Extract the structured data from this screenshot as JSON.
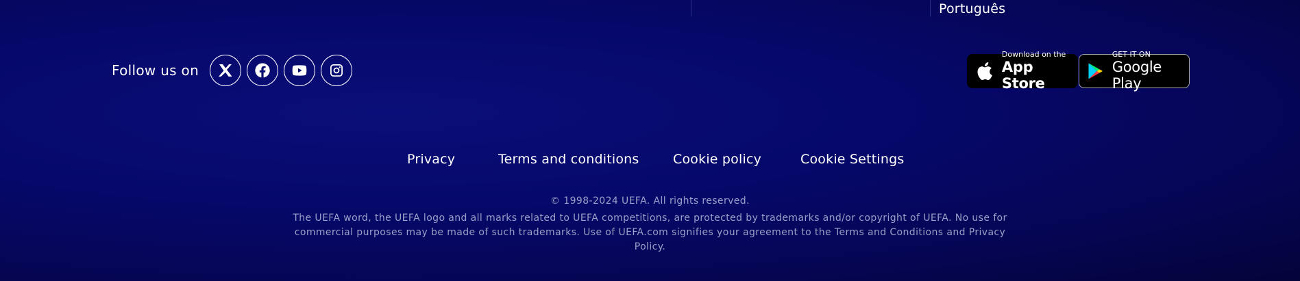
{
  "language": {
    "current": "Português"
  },
  "social": {
    "label": "Follow us on",
    "links": [
      {
        "name": "x-icon"
      },
      {
        "name": "facebook-icon"
      },
      {
        "name": "youtube-icon"
      },
      {
        "name": "instagram-icon"
      }
    ]
  },
  "apps": {
    "appstore": {
      "small": "Download on the",
      "large": "App Store"
    },
    "googleplay": {
      "small": "GET IT ON",
      "large": "Google Play"
    }
  },
  "footer_nav": {
    "privacy": "Privacy",
    "terms": "Terms and conditions",
    "cookie_policy": "Cookie policy",
    "cookie_settings": "Cookie Settings"
  },
  "legal": {
    "copyright": "© 1998-2024 UEFA. All rights reserved.",
    "notice": "The UEFA word, the UEFA logo and all marks related to UEFA competitions, are protected by trademarks and/or copyright of UEFA. No use for commercial purposes may be made of such trademarks. Use of UEFA.com signifies your agreement to the Terms and Conditions and Privacy Policy."
  },
  "colors": {
    "background": "#06086a",
    "muted_text": "#9aa0c8"
  }
}
